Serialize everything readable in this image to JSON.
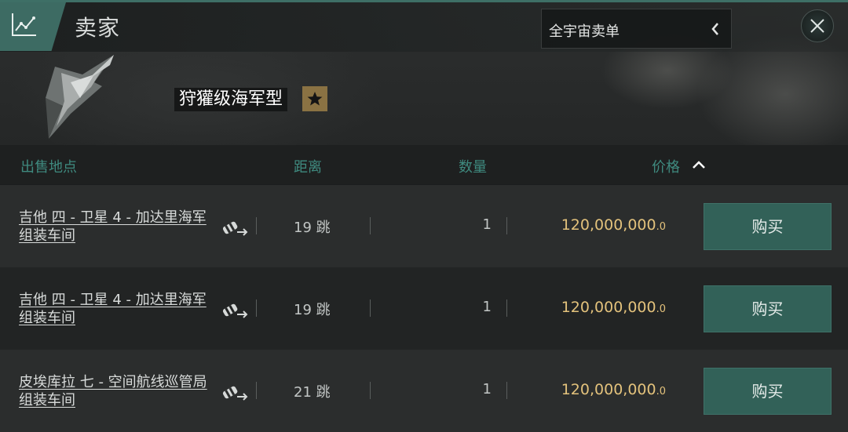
{
  "header": {
    "title": "卖家",
    "region_selector": "全宇宙卖单",
    "accent_color": "#3d6b63"
  },
  "item": {
    "name": "狩獾级海军型",
    "badge_color": "#8a7243"
  },
  "columns": {
    "location": "出售地点",
    "distance": "距离",
    "quantity": "数量",
    "price": "价格"
  },
  "orders": [
    {
      "location": "吉他 四 - 卫星 4 - 加达里海军 组装车间",
      "distance": "19 跳",
      "quantity": "1",
      "price_main": "120,000,000",
      "price_decimal": ".0",
      "buy_label": "购买"
    },
    {
      "location": "吉他 四 - 卫星 4 - 加达里海军 组装车间",
      "distance": "19 跳",
      "quantity": "1",
      "price_main": "120,000,000",
      "price_decimal": ".0",
      "buy_label": "购买"
    },
    {
      "location": "皮埃库拉 七 - 空间航线巡管局 组装车间",
      "distance": "21 跳",
      "quantity": "1",
      "price_main": "120,000,000",
      "price_decimal": ".0",
      "buy_label": "购买"
    }
  ],
  "colors": {
    "price": "#e3c27c",
    "header_text": "#3f8a7f",
    "buy_button": "#326158"
  }
}
